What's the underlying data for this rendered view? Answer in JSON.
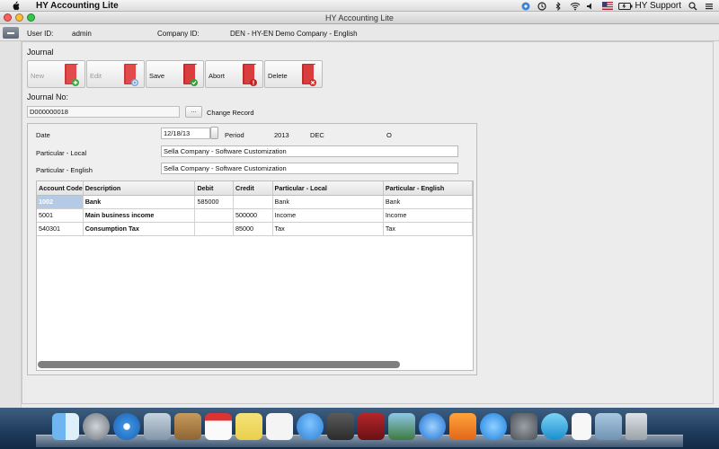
{
  "menubar": {
    "app_name": "HY Accounting Lite",
    "user_name": "HY Support"
  },
  "window": {
    "title": "HY Accounting Lite"
  },
  "info": {
    "user_id_label": "User ID:",
    "user_id_value": "admin",
    "company_id_label": "Company ID:",
    "company_id_value": "DEN - HY-EN Demo Company - English"
  },
  "journal": {
    "section_title": "Journal",
    "journal_no_label": "Journal No:",
    "journal_no_value": "D000000018",
    "browse_label": "...",
    "change_record_label": "Change Record"
  },
  "toolbar": {
    "new_label": "New",
    "edit_label": "Edit",
    "save_label": "Save",
    "abort_label": "Abort",
    "delete_label": "Delete"
  },
  "form": {
    "date_label": "Date",
    "date_value": "12/18/13",
    "period_label": "Period",
    "period_year": "2013",
    "period_month": "DEC",
    "period_flag": "O",
    "particular_local_label": "Particular - Local",
    "particular_local_value": "Sella Company - Software Customization",
    "particular_english_label": "Particular - English",
    "particular_english_value": "Sella Company - Software Customization"
  },
  "grid": {
    "columns": [
      "Account Code",
      "Description",
      "Debit",
      "Credit",
      "Particular - Local",
      "Particular - English"
    ],
    "rows": [
      [
        "1002",
        "Bank",
        "585000",
        "",
        "Bank",
        "Bank"
      ],
      [
        "5001",
        "Main business income",
        "",
        "500000",
        "Income",
        "Income"
      ],
      [
        "540301",
        "Consumption Tax",
        "",
        "85000",
        "Tax",
        "Tax"
      ]
    ]
  },
  "colors": {
    "selection": "#b5cbe5",
    "dock": "#1f3b5c",
    "scrollbar": "#7f7f7f"
  }
}
